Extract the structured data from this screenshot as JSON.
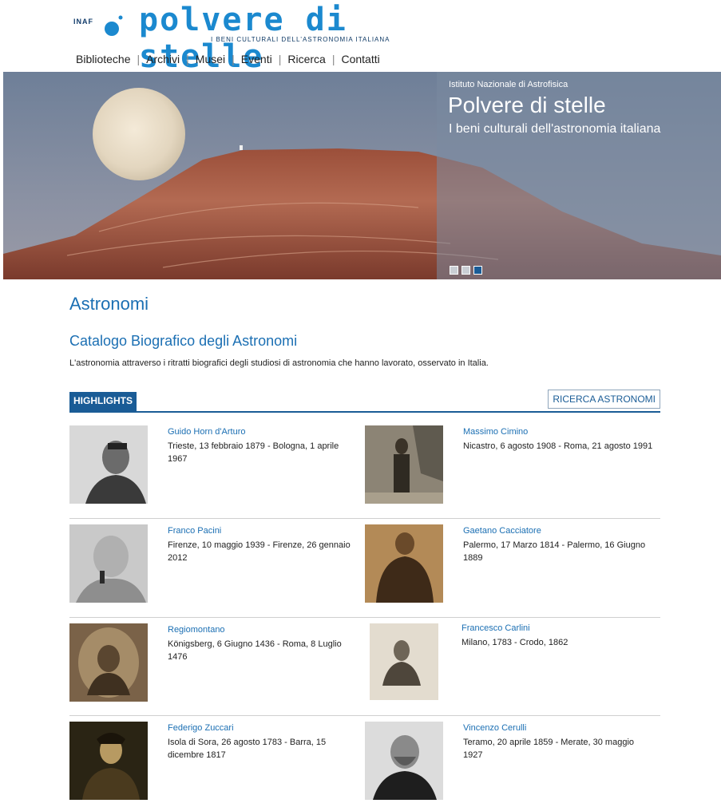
{
  "header": {
    "org": "INAF",
    "site_title": "polvere di stelle",
    "site_subtitle": "I BENI CULTURALI DELL'ASTRONOMIA ITALIANA"
  },
  "nav": [
    {
      "label": "Biblioteche"
    },
    {
      "label": "Archivi"
    },
    {
      "label": "Musei"
    },
    {
      "label": "Eventi"
    },
    {
      "label": "Ricerca"
    },
    {
      "label": "Contatti"
    }
  ],
  "hero": {
    "kicker": "Istituto Nazionale di Astrofisica",
    "title": "Polvere di stelle",
    "subtitle": "I beni culturali dell'astronomia italiana",
    "slides": 3,
    "active_slide": 3
  },
  "page": {
    "title": "Astronomi",
    "section_title": "Catalogo Biografico degli Astronomi",
    "intro": "L'astronomia attraverso i ritratti biografici degli studiosi di astronomia che hanno lavorato, osservato in Italia."
  },
  "tabs": {
    "highlights": "HIGHLIGHTS",
    "search_button": "RICERCA ASTRONOMI"
  },
  "astronomers": [
    {
      "name": "Guido Horn d'Arturo",
      "dates": "Trieste, 13 febbraio 1879 - Bologna, 1 aprile 1967"
    },
    {
      "name": "Massimo Cimino",
      "dates": "Nicastro, 6 agosto 1908 - Roma, 21 agosto 1991"
    },
    {
      "name": "Franco Pacini",
      "dates": "Firenze, 10 maggio 1939 - Firenze, 26 gennaio 2012"
    },
    {
      "name": "Gaetano Cacciatore",
      "dates": "Palermo, 17 Marzo 1814 - Palermo, 16 Giugno 1889"
    },
    {
      "name": "Regiomontano",
      "dates": "Königsberg, 6 Giugno 1436 - Roma, 8 Luglio 1476"
    },
    {
      "name": "Francesco Carlini",
      "dates": "Milano, 1783 - Crodo, 1862"
    },
    {
      "name": "Federigo Zuccari",
      "dates": "Isola di Sora, 26 agosto 1783 - Barra, 15 dicembre 1817"
    },
    {
      "name": "Vincenzo Cerulli",
      "dates": "Teramo, 20 aprile 1859 - Merate, 30 maggio 1927"
    }
  ],
  "colors": {
    "accent": "#1b6fb3",
    "tab": "#1a5c96",
    "logo": "#1b89cf"
  }
}
